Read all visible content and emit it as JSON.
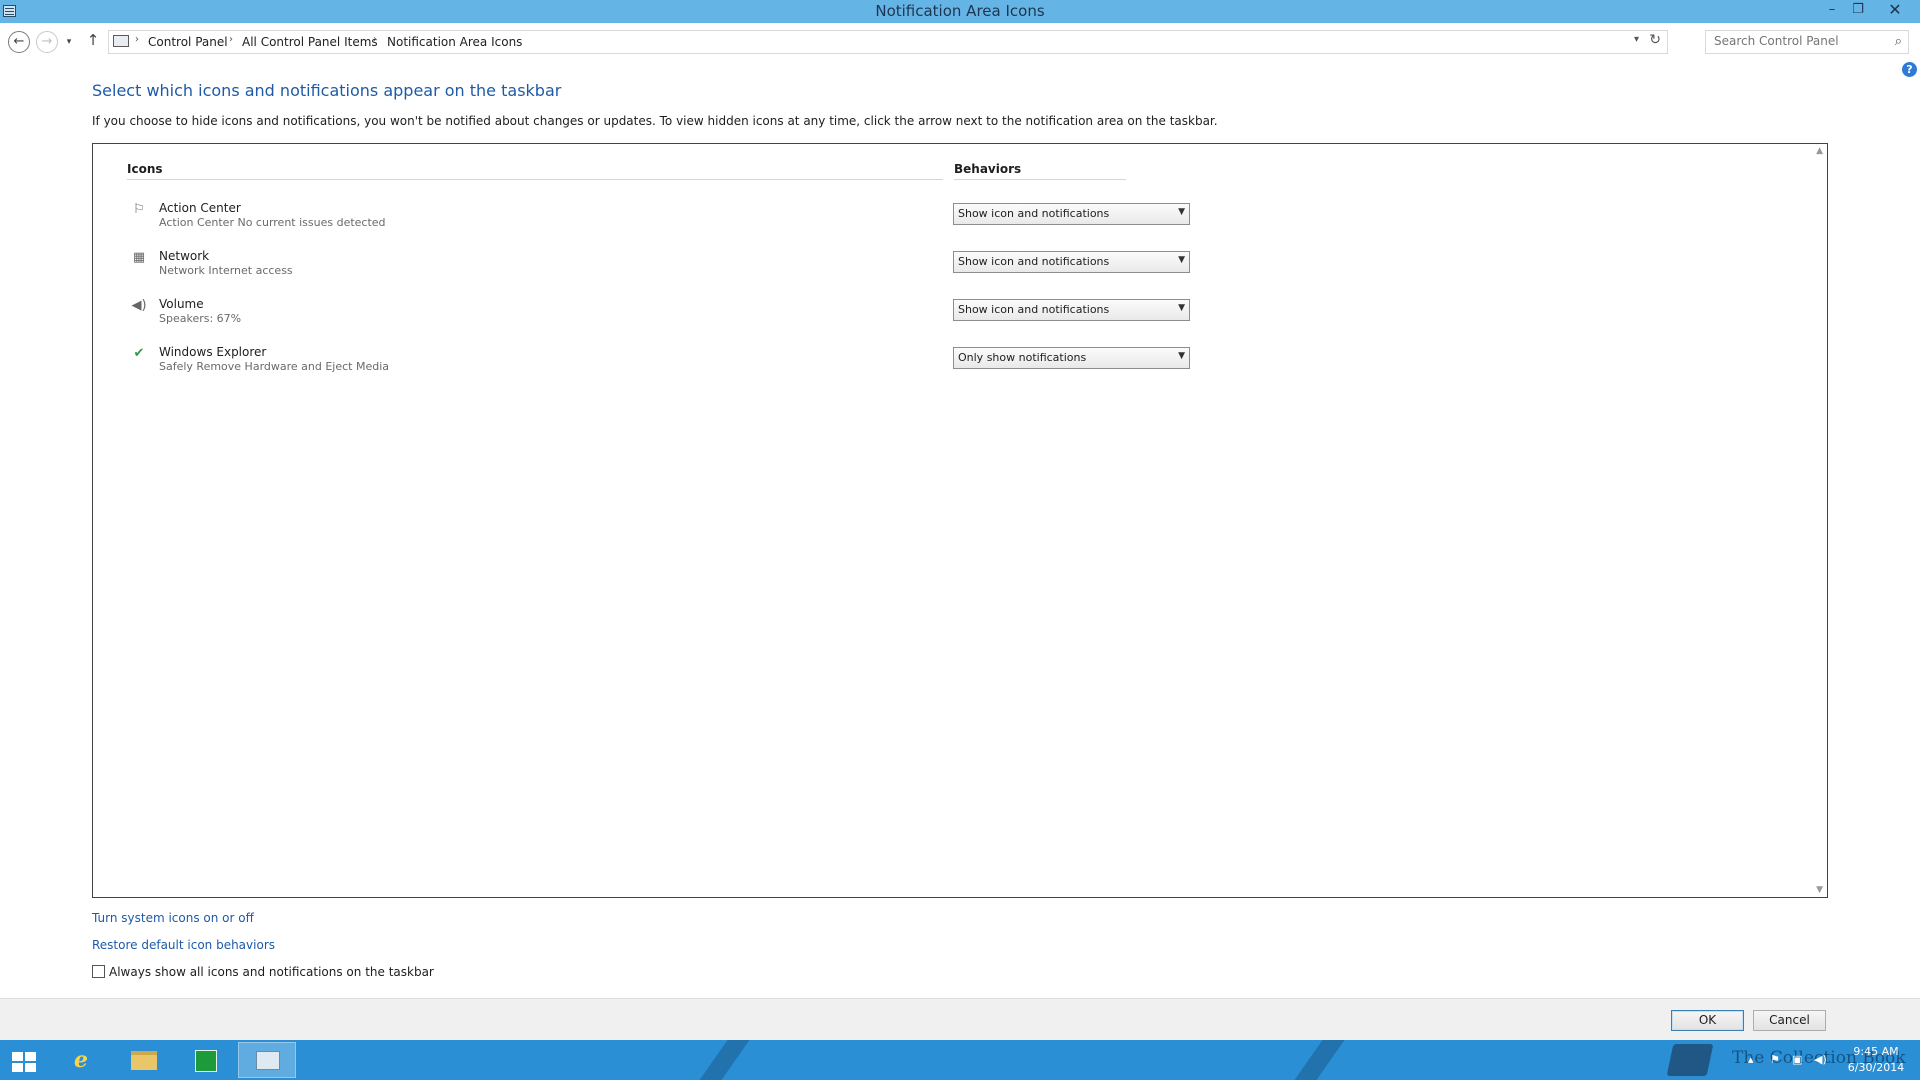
{
  "window": {
    "title": "Notification Area Icons",
    "minimize": "–",
    "maximize": "❐",
    "close": "✕"
  },
  "navigation": {
    "back": "←",
    "forward": "→",
    "recent": "▾",
    "up": "↑",
    "breadcrumbs": [
      "Control Panel",
      "All Control Panel Items",
      "Notification Area Icons"
    ],
    "separator": "›",
    "dropdown": "▾",
    "refresh": "↻",
    "search_placeholder": "Search Control Panel",
    "search_icon": "search-icon"
  },
  "help": "?",
  "main": {
    "title": "Select which icons and notifications appear on the taskbar",
    "description": "If you choose to hide icons and notifications, you won't be notified about changes or updates. To view hidden icons at any time, click the arrow next to the notification area on the taskbar."
  },
  "table": {
    "headers": {
      "icons": "Icons",
      "behaviors": "Behaviors"
    },
    "rows": [
      {
        "name": "Action Center",
        "description": "Action Center  No current issues detected",
        "behavior": "Show icon and notifications",
        "icon": "flag-icon"
      },
      {
        "name": "Network",
        "description": "Network Internet access",
        "behavior": "Show icon and notifications",
        "icon": "network-icon"
      },
      {
        "name": "Volume",
        "description": "Speakers: 67%",
        "behavior": "Show icon and notifications",
        "icon": "speaker-icon"
      },
      {
        "name": "Windows Explorer",
        "description": "Safely Remove Hardware and Eject Media",
        "behavior": "Only show notifications",
        "icon": "usb-eject-icon"
      }
    ]
  },
  "links": {
    "system_icons": "Turn system icons on or off",
    "restore_defaults": "Restore default icon behaviors"
  },
  "checkbox": {
    "label": "Always show all icons and notifications on the taskbar",
    "checked": false
  },
  "buttons": {
    "ok": "OK",
    "cancel": "Cancel"
  },
  "taskbar": {
    "ie_glyph": "e",
    "watermark": "The Collection Book",
    "tray_chevron": "▴",
    "tray_flag": "⚑",
    "tray_network": "▣",
    "tray_volume": "◀)",
    "time": "9:45 AM",
    "date": "6/30/2014"
  },
  "colors": {
    "titlebar": "#64b5e6",
    "taskbar": "#2b8fd6",
    "link": "#1e5aa8"
  }
}
